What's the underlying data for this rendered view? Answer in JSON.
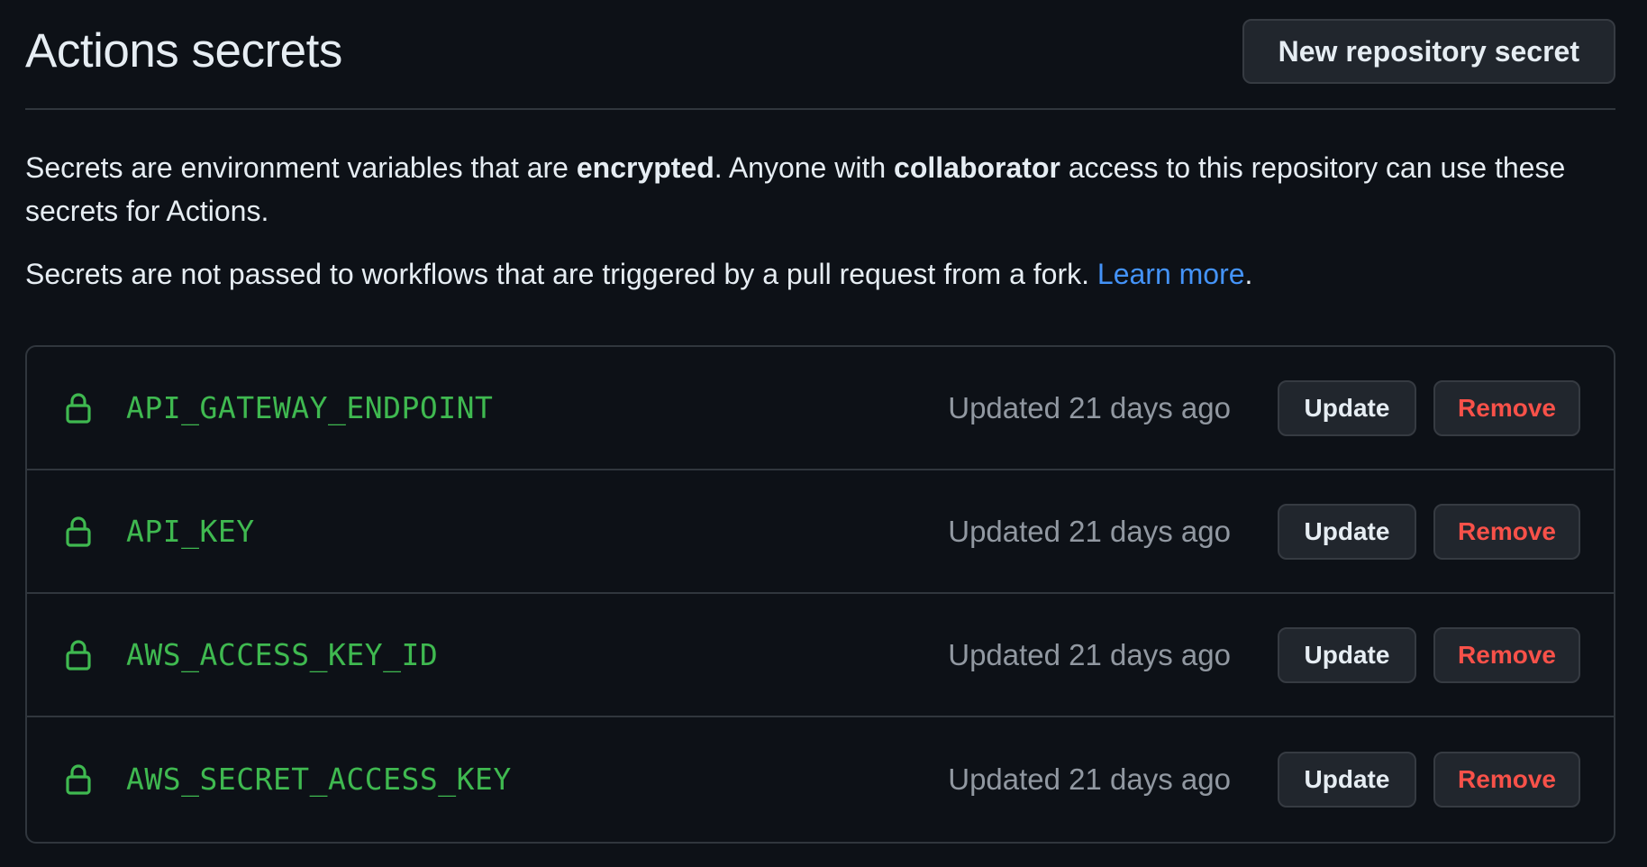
{
  "header": {
    "title": "Actions secrets",
    "new_button_label": "New repository secret"
  },
  "description": {
    "p1_part1": "Secrets are environment variables that are ",
    "p1_bold1": "encrypted",
    "p1_part2": ". Anyone with ",
    "p1_bold2": "collaborator",
    "p1_part3": " access to this repository can use these secrets for Actions.",
    "p2_text": "Secrets are not passed to workflows that are triggered by a pull request from a fork. ",
    "p2_link": "Learn more",
    "p2_end": "."
  },
  "secrets": [
    {
      "name": "API_GATEWAY_ENDPOINT",
      "updated": "Updated 21 days ago",
      "update_label": "Update",
      "remove_label": "Remove",
      "icon": "lock-icon"
    },
    {
      "name": "API_KEY",
      "updated": "Updated 21 days ago",
      "update_label": "Update",
      "remove_label": "Remove",
      "icon": "lock-icon"
    },
    {
      "name": "AWS_ACCESS_KEY_ID",
      "updated": "Updated 21 days ago",
      "update_label": "Update",
      "remove_label": "Remove",
      "icon": "lock-icon"
    },
    {
      "name": "AWS_SECRET_ACCESS_KEY",
      "updated": "Updated 21 days ago",
      "update_label": "Update",
      "remove_label": "Remove",
      "icon": "lock-icon"
    }
  ],
  "colors": {
    "background": "#0d1117",
    "border": "#30363d",
    "secret_name": "#3fb950",
    "remove_text": "#f85149",
    "link": "#4493f8",
    "muted_text": "#9198a1"
  }
}
